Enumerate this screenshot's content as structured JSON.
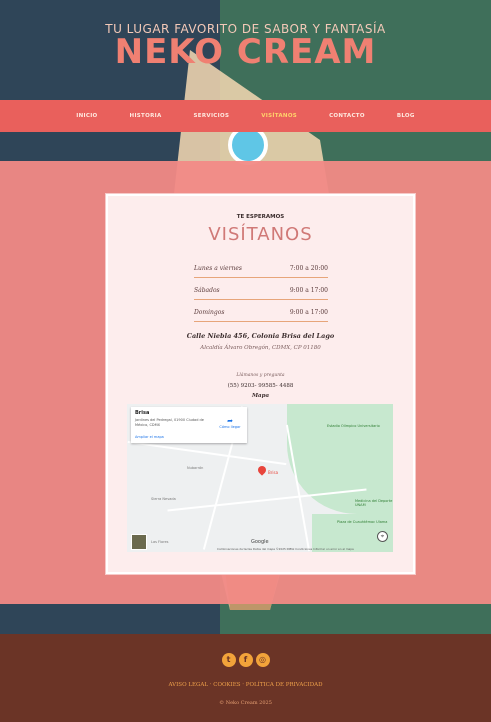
{
  "header": {
    "tagline": "TU LUGAR FAVORITO DE SABOR Y FANTASÍA",
    "title": "NEKO CREAM"
  },
  "nav": {
    "items": [
      {
        "label": "INICIO"
      },
      {
        "label": "HISTORIA"
      },
      {
        "label": "SERVICIOS"
      },
      {
        "label": "VISÍTANOS"
      },
      {
        "label": "CONTACTO"
      },
      {
        "label": "BLOG"
      }
    ],
    "active": "VISÍTANOS"
  },
  "visit": {
    "eyebrow": "TE ESPERAMOS",
    "heading": "VISÍTANOS",
    "hours": [
      {
        "day": "Lunes a viernes",
        "time": "7:00 a 20:00"
      },
      {
        "day": "Sábados",
        "time": "9:00 a 17:00"
      },
      {
        "day": "Domingos",
        "time": "9:00 a 17:00"
      }
    ],
    "address_line1": "Calle Niebla 456, Colonia Brisa del Lago",
    "address_line2": "Alcaldía Álvaro Obregón, CDMX, CP 01180",
    "call_label": "Llámanos y pregunta",
    "phone": "(55) 9203- 99585- 4488",
    "map_label": "Mapa"
  },
  "map": {
    "place_name": "Brisa",
    "place_address": "Jardines del Pedregal, 01900 Ciudad de México, CDMX",
    "directions": "Cómo llegar",
    "bigger_map": "Ampliar el mapa",
    "pin_label": "Brisa",
    "labels": {
      "park": "Estadio Olímpico Universitario",
      "street1": "Nubarrón",
      "street2": "Sierra Nevada",
      "school": "Medicina del Deporte UNAM",
      "plaza": "Plaza de Cuauhtémoc Ulama",
      "stop": "Las Flores"
    },
    "footer": "Combinaciones de teclas   Datos del mapa ©2025 INEGI   Condiciones   Informar un error en el mapa",
    "google": "Google"
  },
  "footer": {
    "socials": [
      {
        "icon": "twitter-icon",
        "glyph": "t"
      },
      {
        "icon": "facebook-icon",
        "glyph": "f"
      },
      {
        "icon": "instagram-icon",
        "glyph": "◎"
      }
    ],
    "links": "AVISO LEGAL · COOKIES · POLÍTICA DE PRIVACIDAD",
    "copyright": "© Neko Cream 2025"
  },
  "colors": {
    "nav": "#e9605c",
    "active_nav": "#ffd36b",
    "title": "#f08072",
    "footer": "#6b3426",
    "social": "#f2a33a"
  }
}
